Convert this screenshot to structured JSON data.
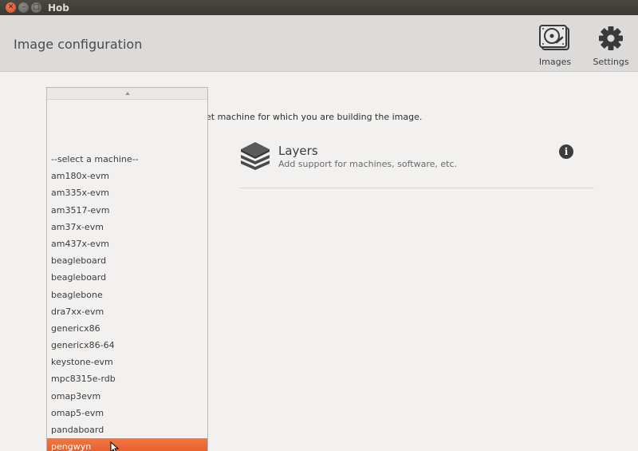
{
  "window": {
    "title": "Hob"
  },
  "header": {
    "title": "Image configuration",
    "images_label": "Images",
    "settings_label": "Settings"
  },
  "main": {
    "instruction": "et machine for which you are building the image."
  },
  "layers": {
    "title": "Layers",
    "subtitle": "Add support for machines, software, etc."
  },
  "machine_menu": {
    "items": [
      "--select a machine--",
      "am180x-evm",
      "am335x-evm",
      "am3517-evm",
      "am37x-evm",
      "am437x-evm",
      "beagleboard",
      "beagleboard",
      "beaglebone",
      "dra7xx-evm",
      "genericx86",
      "genericx86-64",
      "keystone-evm",
      "mpc8315e-rdb",
      "omap3evm",
      "omap5-evm",
      "pandaboard",
      "pengwyn"
    ],
    "selected_index": 17
  },
  "colors": {
    "accent": "#e86f3c",
    "titlebar": "#3c3b37",
    "header": "#dcdbda",
    "background": "#f2f1f0"
  }
}
